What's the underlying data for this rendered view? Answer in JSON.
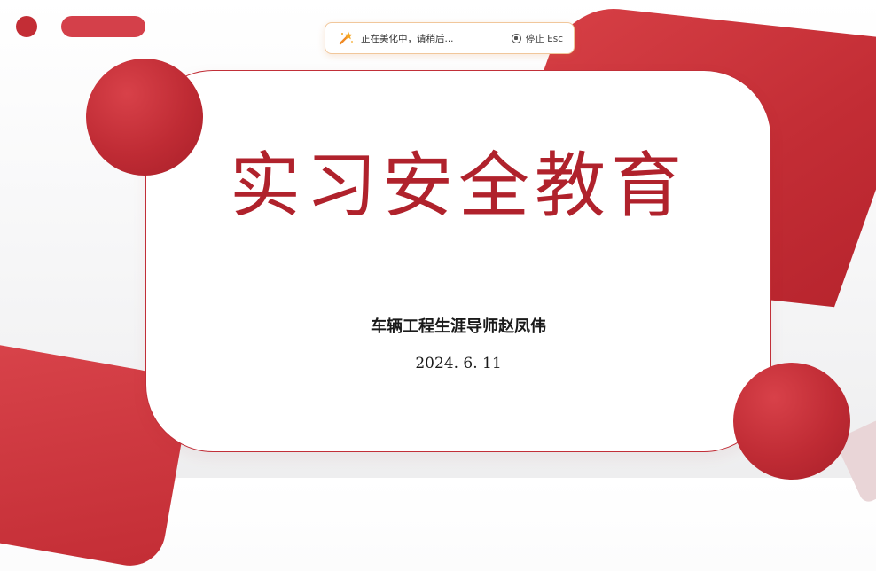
{
  "toast": {
    "status_text": "正在美化中，请稍后...",
    "stop_label": "停止 Esc",
    "wand_icon": "magic-wand-icon",
    "stop_icon": "stop-circle-icon"
  },
  "slide": {
    "title": "实习安全教育",
    "presenter": "车辆工程生涯导师赵凤伟",
    "date": "2024. 6. 11"
  },
  "colors": {
    "accent": "#c32d35",
    "title": "#b0222c",
    "toast_border": "#f1c79b"
  }
}
